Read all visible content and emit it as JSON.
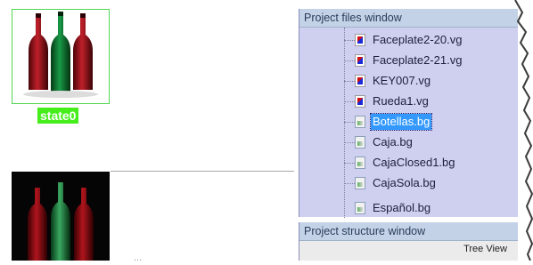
{
  "left_editor": {
    "state_label": "state0",
    "bottom_caption": "..."
  },
  "files_panel": {
    "title": "Project files window",
    "files": [
      {
        "name": "Faceplate2-20.vg",
        "kind": "vg-file-icon"
      },
      {
        "name": "Faceplate2-21.vg",
        "kind": "vg-file-icon"
      },
      {
        "name": "KEY007.vg",
        "kind": "vg-file-icon"
      },
      {
        "name": "Rueda1.vg",
        "kind": "vg-file-icon"
      },
      {
        "name": "Botellas.bg",
        "kind": "bg-file-icon",
        "selected": true
      },
      {
        "name": "Caja.bg",
        "kind": "bg-file-icon"
      },
      {
        "name": "CajaClosed1.bg",
        "kind": "bg-file-icon"
      },
      {
        "name": "CajaSola.bg",
        "kind": "bg-file-icon"
      },
      {
        "name": "Español.bg",
        "kind": "bg-file-icon"
      }
    ]
  },
  "structure_panel": {
    "title": "Project structure window",
    "tab": "Tree View"
  },
  "colors": {
    "panel_bg": "#cfcff0",
    "panel_header": "#c3d2e6",
    "selection": "#3399ff",
    "state_label_bg": "#46ee1c"
  }
}
